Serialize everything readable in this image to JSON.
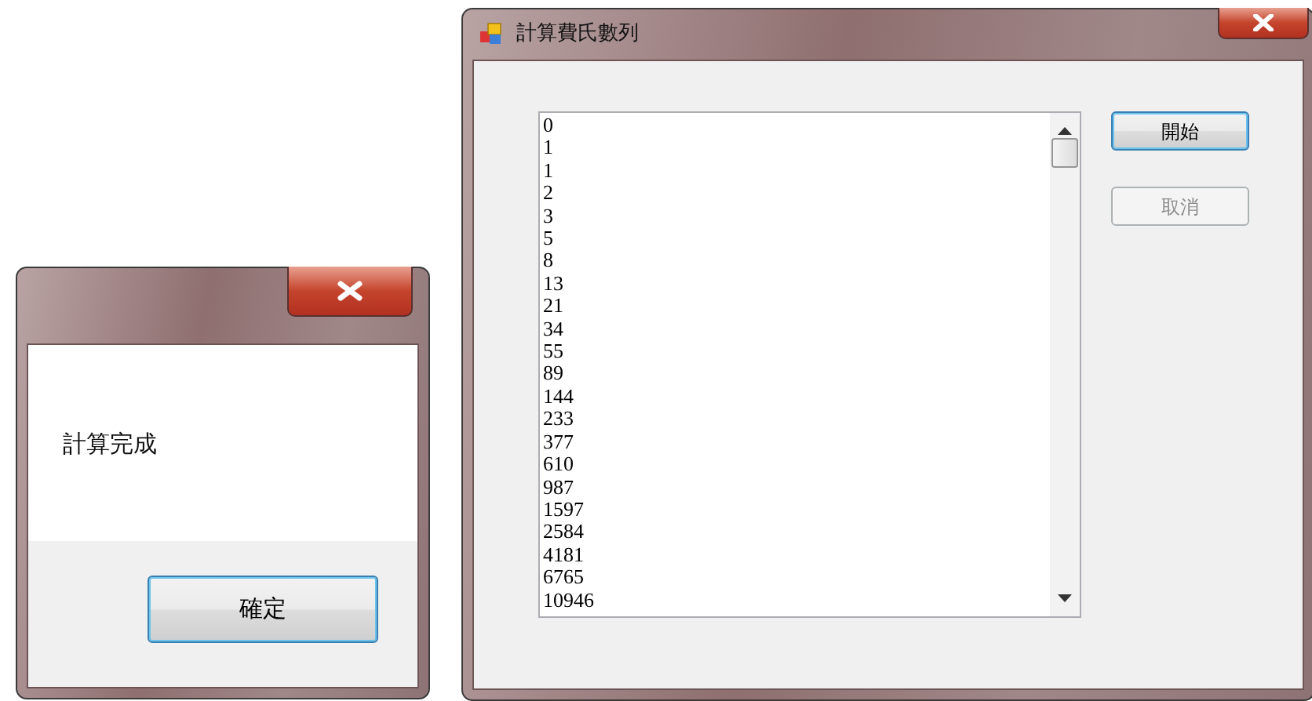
{
  "main_window": {
    "title": "計算費氏數列",
    "list_items": [
      "0",
      "1",
      "1",
      "2",
      "3",
      "5",
      "8",
      "13",
      "21",
      "34",
      "55",
      "89",
      "144",
      "233",
      "377",
      "610",
      "987",
      "1597",
      "2584",
      "4181",
      "6765",
      "10946"
    ],
    "buttons": [
      {
        "label": "開始",
        "focused": true,
        "disabled": false
      },
      {
        "label": "取消",
        "focused": false,
        "disabled": true
      }
    ]
  },
  "dialog": {
    "message": "計算完成",
    "button": {
      "label": "確定",
      "focused": true,
      "disabled": false
    }
  }
}
